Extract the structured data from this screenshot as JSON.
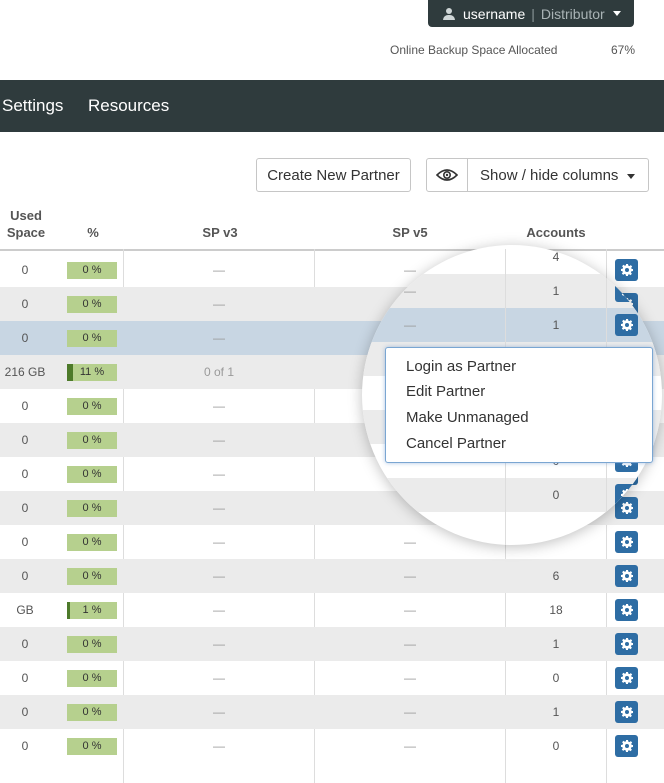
{
  "header": {
    "username": "username",
    "separator": "|",
    "role": "Distributor",
    "backup_label": "Online Backup Space Allocated",
    "backup_percent": "67%",
    "backup_fraction": 0.67
  },
  "nav": {
    "items": [
      "Settings",
      "Resources"
    ]
  },
  "toolbar": {
    "create_label": "Create New Partner",
    "showhide_label": "Show / hide columns"
  },
  "table": {
    "headers": {
      "used_space_line1": "Used",
      "used_space_line2": "Space",
      "percent": "%",
      "sp_v3": "SP v3",
      "sp_v5": "SP v5",
      "accounts": "Accounts"
    },
    "rows": [
      {
        "used": "0",
        "pct": "0 %",
        "pct_fill": 0,
        "spv3": "—",
        "spv5": "—",
        "accounts": "4"
      },
      {
        "used": "0",
        "pct": "0 %",
        "pct_fill": 0,
        "spv3": "—",
        "spv5": "—",
        "accounts": "1"
      },
      {
        "used": "0",
        "pct": "0 %",
        "pct_fill": 0,
        "spv3": "—",
        "spv5": "—",
        "accounts": "1"
      },
      {
        "used": "216 GB",
        "pct": "11 %",
        "pct_fill": 0.11,
        "spv3": "0 of 1",
        "spv5": "",
        "accounts": ""
      },
      {
        "used": "0",
        "pct": "0 %",
        "pct_fill": 0,
        "spv3": "—",
        "spv5": "",
        "accounts": ""
      },
      {
        "used": "0",
        "pct": "0 %",
        "pct_fill": 0,
        "spv3": "—",
        "spv5": "",
        "accounts": ""
      },
      {
        "used": "0",
        "pct": "0 %",
        "pct_fill": 0,
        "spv3": "—",
        "spv5": "—",
        "accounts": "0"
      },
      {
        "used": "0",
        "pct": "0 %",
        "pct_fill": 0,
        "spv3": "—",
        "spv5": "",
        "accounts": "0"
      },
      {
        "used": "0",
        "pct": "0 %",
        "pct_fill": 0,
        "spv3": "—",
        "spv5": "—",
        "accounts": ""
      },
      {
        "used": "0",
        "pct": "0 %",
        "pct_fill": 0,
        "spv3": "—",
        "spv5": "—",
        "accounts": "6"
      },
      {
        "used": "GB",
        "pct": "1 %",
        "pct_fill": 0.01,
        "spv3": "—",
        "spv5": "—",
        "accounts": "18"
      },
      {
        "used": "0",
        "pct": "0 %",
        "pct_fill": 0,
        "spv3": "—",
        "spv5": "—",
        "accounts": "1"
      },
      {
        "used": "0",
        "pct": "0 %",
        "pct_fill": 0,
        "spv3": "—",
        "spv5": "—",
        "accounts": "0"
      },
      {
        "used": "0",
        "pct": "0 %",
        "pct_fill": 0,
        "spv3": "—",
        "spv5": "—",
        "accounts": "1"
      },
      {
        "used": "0",
        "pct": "0 %",
        "pct_fill": 0,
        "spv3": "—",
        "spv5": "—",
        "accounts": "0"
      }
    ]
  },
  "context_menu": {
    "items": [
      "Login as Partner",
      "Edit Partner",
      "Make Unmanaged",
      "Cancel Partner"
    ]
  },
  "icons": {
    "user": "user-icon",
    "eye": "eye-icon",
    "gear": "gear-icon"
  },
  "colors": {
    "dark": "#2f3b3d",
    "gear_bg": "#2e6da4",
    "pct_bar": "#b6d08e",
    "selected_row": "#c8d6e3"
  }
}
